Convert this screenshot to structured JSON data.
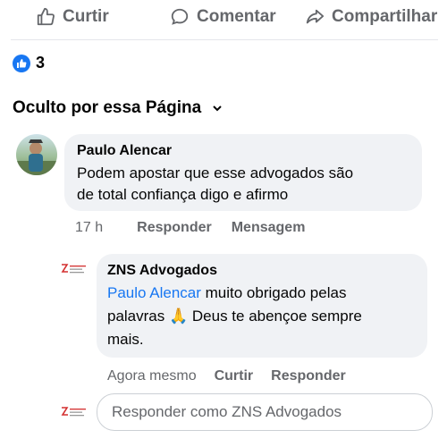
{
  "actions": {
    "like": "Curtir",
    "comment": "Comentar",
    "share": "Compartilhar"
  },
  "reactions": {
    "count": "3"
  },
  "filter": {
    "label": "Oculto por essa Página"
  },
  "comment": {
    "author": "Paulo Alencar",
    "line1": "Podem apostar que esse advogados são",
    "line2": "de total confiança digo e afirmo",
    "time": "17 h",
    "reply": "Responder",
    "message": "Mensagem"
  },
  "reply": {
    "author": "ZNS Advogados",
    "mention": "Paulo Alencar",
    "text1": " muito obrigado pelas",
    "text2a": "palavras ",
    "emoji": "🙏",
    "text2b": " Deus te abençoe sempre",
    "text3": "mais.",
    "time": "Agora mesmo",
    "like": "Curtir",
    "reply": "Responder"
  },
  "composer": {
    "placeholder": "Responder como ZNS Advogados"
  },
  "colors": {
    "accent": "#1877f2",
    "bubble": "#f0f2f5",
    "muted": "#65676b",
    "logo_red": "#d32f2f"
  },
  "icons": [
    "thumbs-up-icon",
    "comment-icon",
    "share-icon",
    "like-badge-icon",
    "chevron-down-icon",
    "zns-logo-icon"
  ]
}
